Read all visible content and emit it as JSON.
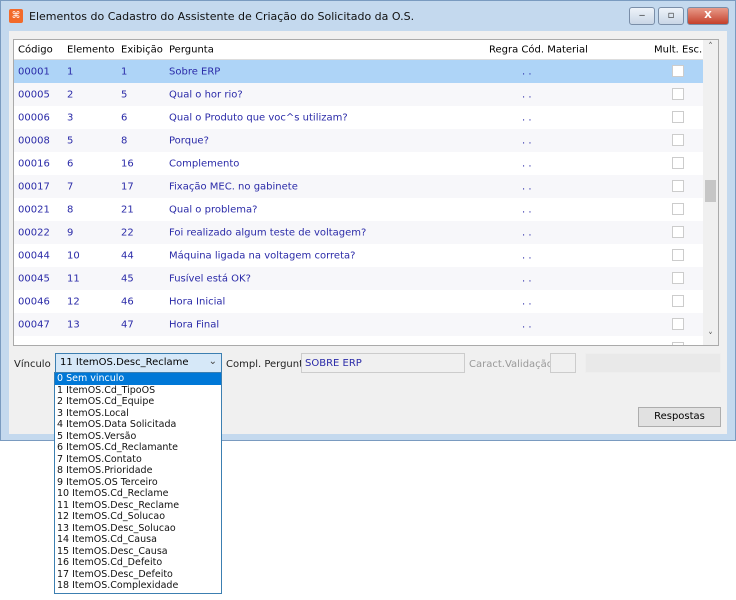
{
  "window": {
    "title": "Elementos do Cadastro do Assistente de Criação do Solicitado da O.S.",
    "min": "‒",
    "max": "▫",
    "close": "X"
  },
  "grid": {
    "headers": [
      "Código",
      "Elemento",
      "Exibição",
      "Pergunta",
      "Regra Cód. Material",
      "Mult. Esc."
    ],
    "rows": [
      {
        "codigo": "00001",
        "elemento": "1",
        "exibicao": "1",
        "pergunta": "Sobre ERP",
        "regra": ". .",
        "selected": true
      },
      {
        "codigo": "00005",
        "elemento": "2",
        "exibicao": "5",
        "pergunta": "Qual o hor rio?",
        "regra": ". ."
      },
      {
        "codigo": "00006",
        "elemento": "3",
        "exibicao": "6",
        "pergunta": "Qual o Produto que voc^s utilizam?",
        "regra": ". ."
      },
      {
        "codigo": "00008",
        "elemento": "5",
        "exibicao": "8",
        "pergunta": "Porque?",
        "regra": ". ."
      },
      {
        "codigo": "00016",
        "elemento": "6",
        "exibicao": "16",
        "pergunta": "Complemento",
        "regra": ". ."
      },
      {
        "codigo": "00017",
        "elemento": "7",
        "exibicao": "17",
        "pergunta": "Fixação MEC. no gabinete",
        "regra": ". ."
      },
      {
        "codigo": "00021",
        "elemento": "8",
        "exibicao": "21",
        "pergunta": "Qual o problema?",
        "regra": ". ."
      },
      {
        "codigo": "00022",
        "elemento": "9",
        "exibicao": "22",
        "pergunta": "Foi realizado algum teste de voltagem?",
        "regra": ". ."
      },
      {
        "codigo": "00044",
        "elemento": "10",
        "exibicao": "44",
        "pergunta": "Máquina ligada na voltagem correta?",
        "regra": ". ."
      },
      {
        "codigo": "00045",
        "elemento": "11",
        "exibicao": "45",
        "pergunta": "Fusível está OK?",
        "regra": ". ."
      },
      {
        "codigo": "00046",
        "elemento": "12",
        "exibicao": "46",
        "pergunta": "Hora Inicial",
        "regra": ". ."
      },
      {
        "codigo": "00047",
        "elemento": "13",
        "exibicao": "47",
        "pergunta": "Hora Final",
        "regra": ". ."
      }
    ]
  },
  "form": {
    "vinculo_label": "Vínculo",
    "vinculo_value": "11 ItemOS.Desc_Reclame",
    "compl_label": "Compl. Pergunta",
    "compl_value": "SOBRE ERP",
    "caract_label": "Caract.Validação",
    "respostas": "Respostas"
  },
  "dropdown": [
    "0 Sem vinculo",
    "1 ItemOS.Cd_TipoOS",
    "2 ItemOS.Cd_Equipe",
    "3 ItemOS.Local",
    "4 ItemOS.Data Solicitada",
    "5 ItemOS.Versão",
    "6 ItemOS.Cd_Reclamante",
    "7 ItemOS.Contato",
    "8 ItemOS.Prioridade",
    "9 ItemOS.OS Terceiro",
    "10 ItemOS.Cd_Reclame",
    "11 ItemOS.Desc_Reclame",
    "12 ItemOS.Cd_Solucao",
    "13 ItemOS.Desc_Solucao",
    "14 ItemOS.Cd_Causa",
    "15 ItemOS.Desc_Causa",
    "16 ItemOS.Cd_Defeito",
    "17 ItemOS.Desc_Defeito",
    "18 ItemOS.Complexidade"
  ]
}
